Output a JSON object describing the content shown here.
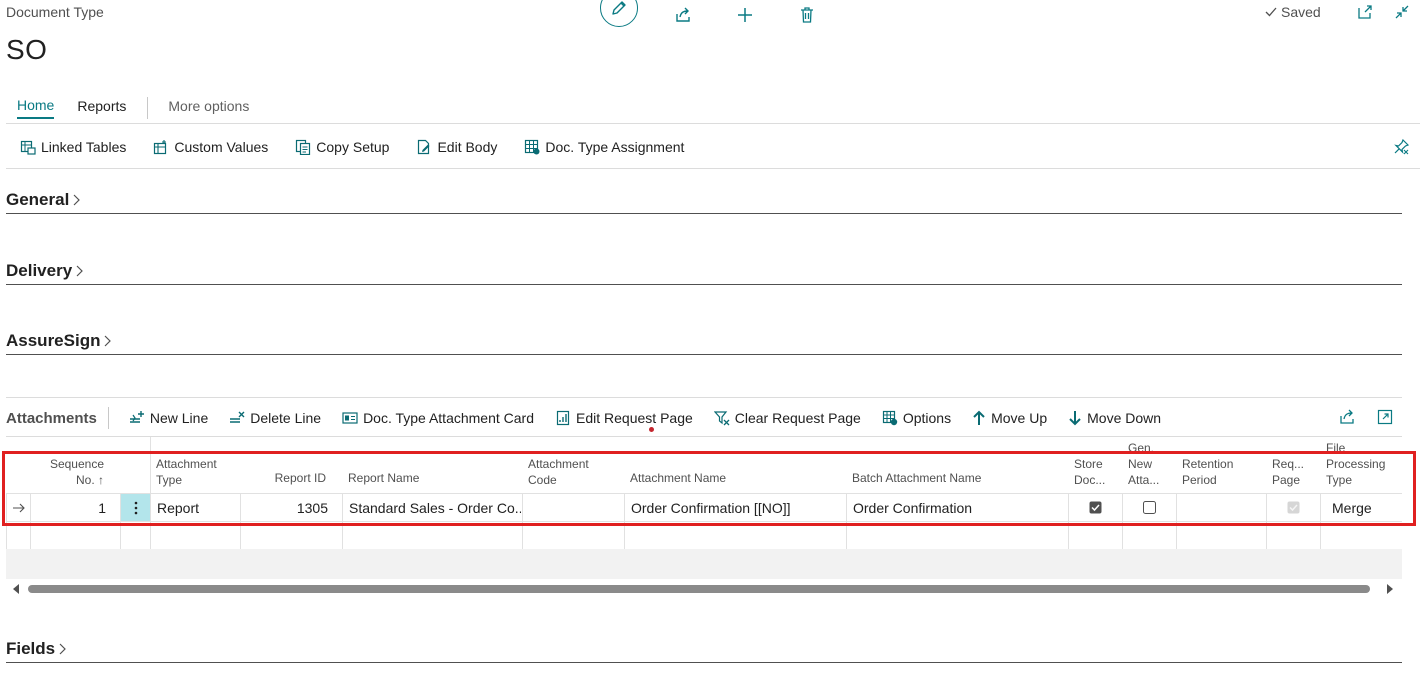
{
  "page": {
    "caption": "Document Type",
    "title": "SO",
    "saved_label": "Saved"
  },
  "tabs": {
    "home": "Home",
    "reports": "Reports",
    "more": "More options"
  },
  "actions": {
    "linked_tables": "Linked Tables",
    "custom_values": "Custom Values",
    "copy_setup": "Copy Setup",
    "edit_body": "Edit Body",
    "doc_type_assignment": "Doc. Type Assignment"
  },
  "sections": {
    "general": "General",
    "delivery": "Delivery",
    "assuresign": "AssureSign",
    "fields": "Fields"
  },
  "attachments": {
    "title": "Attachments",
    "actions": {
      "new_line": "New Line",
      "delete_line": "Delete Line",
      "card": "Doc. Type Attachment Card",
      "edit_request_page": "Edit Request Page",
      "clear_request_page": "Clear Request Page",
      "options": "Options",
      "move_up": "Move Up",
      "move_down": "Move Down"
    },
    "columns": {
      "seq_1": "Sequence",
      "seq_2": "No. ↑",
      "att_type_1": "Attachment",
      "att_type_2": "Type",
      "report_id": "Report ID",
      "report_name": "Report Name",
      "att_code_1": "Attachment",
      "att_code_2": "Code",
      "att_name": "Attachment Name",
      "batch_name": "Batch Attachment Name",
      "store_1": "Store",
      "store_2": "Doc...",
      "gen_0": "Gen.",
      "gen_1": "New",
      "gen_2": "Atta...",
      "retention_1": "Retention",
      "retention_2": "Period",
      "req_1": "Req...",
      "req_2": "Page",
      "proc_0": "File",
      "proc_1": "Processing",
      "proc_2": "Type"
    },
    "row": {
      "sequence": "1",
      "attachment_type": "Report",
      "report_id": "1305",
      "report_name": "Standard Sales - Order Co...",
      "attachment_code": "",
      "attachment_name": "Order Confirmation [[NO]]",
      "batch_attachment_name": "Order Confirmation",
      "store_doc": true,
      "gen_new_attachment": false,
      "retention_period": "",
      "req_page": true,
      "processing_type": "Merge"
    }
  },
  "colors": {
    "accent": "#0a7a83",
    "highlight_box": "#e02020"
  }
}
